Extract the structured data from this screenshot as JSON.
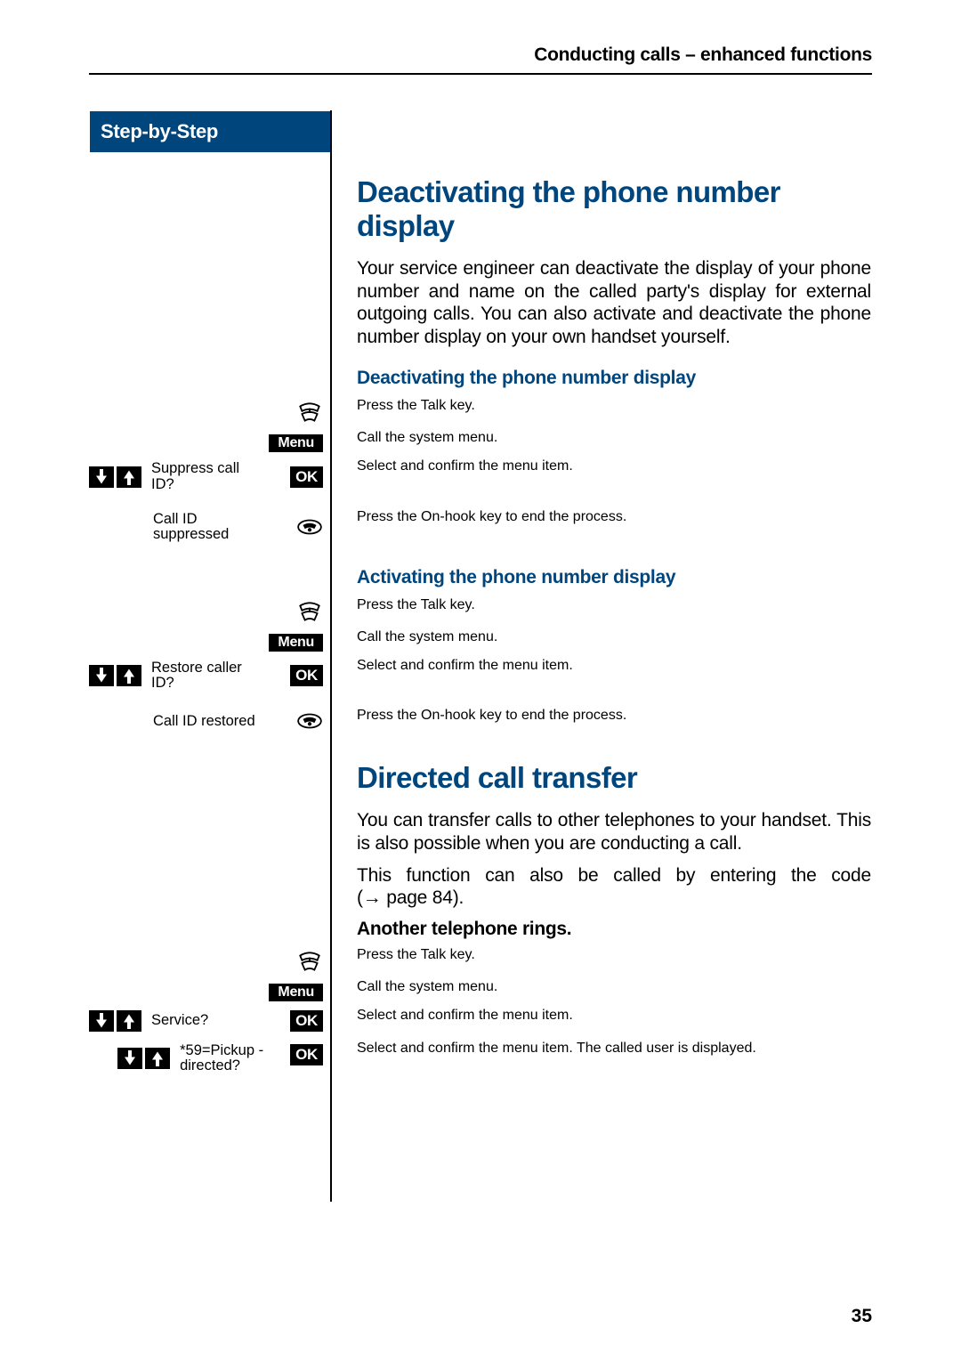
{
  "header": "Conducting calls – enhanced functions",
  "sidebar_title": "Step-by-Step",
  "key_menu": "Menu",
  "key_ok": "OK",
  "page_number": "35",
  "s1": {
    "title": "Deactivating the phone number display",
    "intro": "Your service engineer can deactivate the display of your phone number and name on the called party's display for external outgoing calls. You can also activate and deactivate the phone number display on your own handset yourself.",
    "deact": {
      "title": "Deactivating the phone number display",
      "talk": "Press the Talk key.",
      "menu": "Call the system menu.",
      "select": "Select and confirm the menu item.",
      "sel_label": "Suppress call ID?",
      "onhook": "Press the On-hook key to end the process.",
      "onhook_label": "Call ID suppressed"
    },
    "act": {
      "title": "Activating the phone number display",
      "talk": "Press the Talk key.",
      "menu": "Call the system menu.",
      "select": "Select and confirm the menu item.",
      "sel_label": "Restore caller ID?",
      "onhook": "Press the On-hook key to end the process.",
      "onhook_label": "Call ID restored"
    }
  },
  "s2": {
    "title": "Directed call transfer",
    "intro1": "You can transfer calls to other telephones to your handset. This is also possible when you are conducting a call.",
    "intro2_a": "This function can also be called by entering the code (",
    "intro2_b": " page 84).",
    "sub": "Another telephone rings.",
    "talk": "Press the Talk key.",
    "menu": "Call the system menu.",
    "sel1": "Select and confirm the menu item.",
    "sel1_label": "Service?",
    "sel2": "Select and confirm the menu item. The called user is displayed.",
    "sel2_label": "*59=Pickup - directed?"
  },
  "arrow_char": "→"
}
